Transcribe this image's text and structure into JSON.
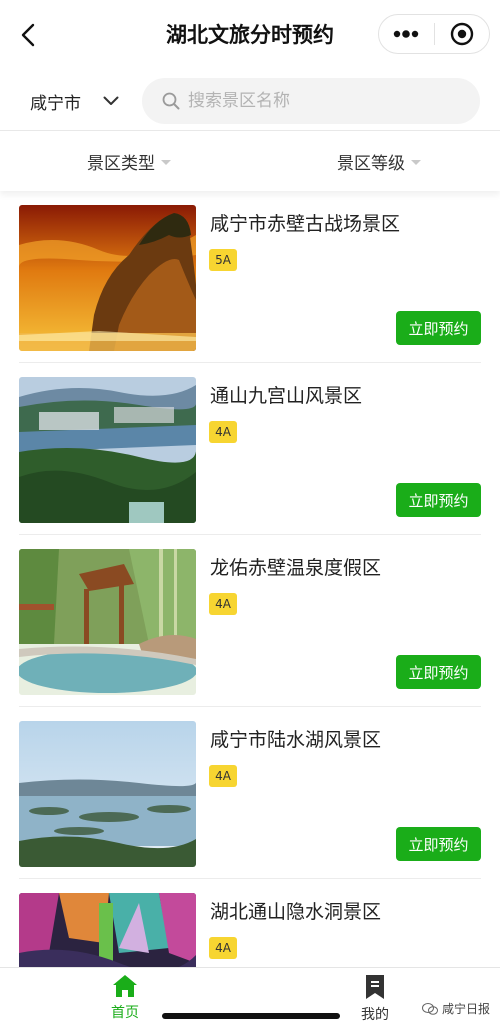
{
  "header": {
    "title": "湖北文旅分时预约"
  },
  "search": {
    "city": "咸宁市",
    "placeholder": "搜索景区名称"
  },
  "filters": {
    "type_label": "景区类型",
    "level_label": "景区等级"
  },
  "list": {
    "items": [
      {
        "name": "咸宁市赤壁古战场景区",
        "level": "5A",
        "button": "立即预约"
      },
      {
        "name": "通山九宫山风景区",
        "level": "4A",
        "button": "立即预约"
      },
      {
        "name": "龙佑赤壁温泉度假区",
        "level": "4A",
        "button": "立即预约"
      },
      {
        "name": "咸宁市陆水湖风景区",
        "level": "4A",
        "button": "立即预约"
      },
      {
        "name": "湖北通山隐水洞景区",
        "level": "4A",
        "button": "立即预约"
      }
    ]
  },
  "tabbar": {
    "home_label": "首页",
    "mine_label": "我的"
  },
  "watermark": {
    "text": "咸宁日报"
  },
  "colors": {
    "accent_green": "#1aad19",
    "badge_yellow": "#f7d531"
  }
}
